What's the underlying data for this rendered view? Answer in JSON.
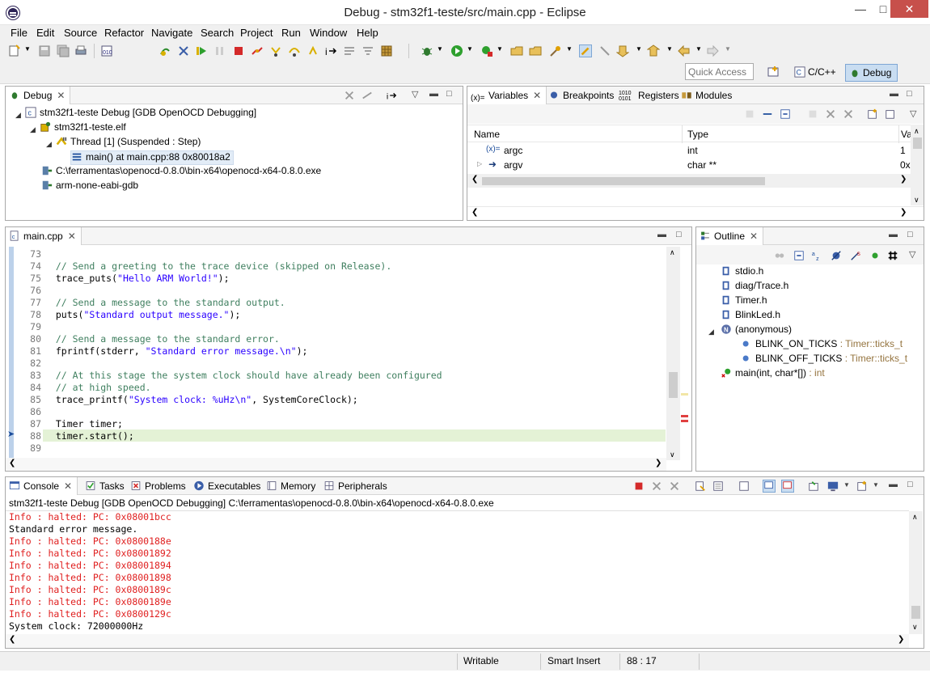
{
  "window": {
    "title": "Debug - stm32f1-teste/src/main.cpp - Eclipse"
  },
  "menu": [
    "File",
    "Edit",
    "Source",
    "Refactor",
    "Navigate",
    "Search",
    "Project",
    "Run",
    "Window",
    "Help"
  ],
  "quick_access": {
    "placeholder": "Quick Access"
  },
  "perspectives": {
    "cc": "C/C++",
    "debug": "Debug"
  },
  "debug_view": {
    "tab": "Debug",
    "rows": [
      "stm32f1-teste Debug [GDB OpenOCD Debugging]",
      "stm32f1-teste.elf",
      "Thread [1] (Suspended : Step)",
      "main() at main.cpp:88 0x80018a2",
      "C:\\ferramentas\\openocd-0.8.0\\bin-x64\\openocd-x64-0.8.0.exe",
      "arm-none-eabi-gdb"
    ]
  },
  "variables_view": {
    "tabs": [
      "Variables",
      "Breakpoints",
      "Registers",
      "Modules"
    ],
    "columns": [
      "Name",
      "Type",
      "Va"
    ],
    "rows": [
      {
        "name": "argc",
        "type": "int",
        "value": "1"
      },
      {
        "name": "argv",
        "type": "char **",
        "value": "0x"
      }
    ]
  },
  "editor": {
    "tab": "main.cpp",
    "line_numbers": [
      "73",
      "74",
      "75",
      "76",
      "77",
      "78",
      "79",
      "80",
      "81",
      "82",
      "83",
      "84",
      "85",
      "86",
      "87",
      "88",
      "89"
    ],
    "lines": {
      "l74": "  // Send a greeting to the trace device (skipped on Release).",
      "l75a": "  trace_puts(",
      "l75b": "\"Hello ARM World!\"",
      "l75c": ");",
      "l77": "  // Send a message to the standard output.",
      "l78a": "  puts(",
      "l78b": "\"Standard output message.\"",
      "l78c": ");",
      "l80": "  // Send a message to the standard error.",
      "l81a": "  fprintf(stderr, ",
      "l81b": "\"Standard error message.\\n\"",
      "l81c": ");",
      "l83": "  // At this stage the system clock should have already been configured",
      "l84": "  // at high speed.",
      "l85a": "  trace_printf(",
      "l85b": "\"System clock: %uHz\\n\"",
      "l85c": ", SystemCoreClock);",
      "l87": "  Timer timer;",
      "l88": "  timer.start();"
    }
  },
  "outline": {
    "tab": "Outline",
    "items": [
      {
        "name": "stdio.h",
        "type": ""
      },
      {
        "name": "diag/Trace.h",
        "type": ""
      },
      {
        "name": "Timer.h",
        "type": ""
      },
      {
        "name": "BlinkLed.h",
        "type": ""
      },
      {
        "name": "(anonymous)",
        "type": ""
      },
      {
        "name": "BLINK_ON_TICKS",
        "type": " : Timer::ticks_t"
      },
      {
        "name": "BLINK_OFF_TICKS",
        "type": " : Timer::ticks_t"
      },
      {
        "name": "main(int, char*[])",
        "type": " : int"
      }
    ]
  },
  "console": {
    "tabs": [
      "Console",
      "Tasks",
      "Problems",
      "Executables",
      "Memory",
      "Peripherals"
    ],
    "header": "stm32f1-teste Debug [GDB OpenOCD Debugging] C:\\ferramentas\\openocd-0.8.0\\bin-x64\\openocd-x64-0.8.0.exe",
    "lines": [
      "Info : halted: PC: 0x08001bcc",
      "Standard error message.",
      "Info : halted: PC: 0x0800188e",
      "Info : halted: PC: 0x08001892",
      "Info : halted: PC: 0x08001894",
      "Info : halted: PC: 0x08001898",
      "Info : halted: PC: 0x0800189c",
      "Info : halted: PC: 0x0800189e",
      "Info : halted: PC: 0x0800129c",
      "System clock: 72000000Hz"
    ]
  },
  "status": {
    "writable": "Writable",
    "insert": "Smart Insert",
    "position": "88 : 17"
  }
}
